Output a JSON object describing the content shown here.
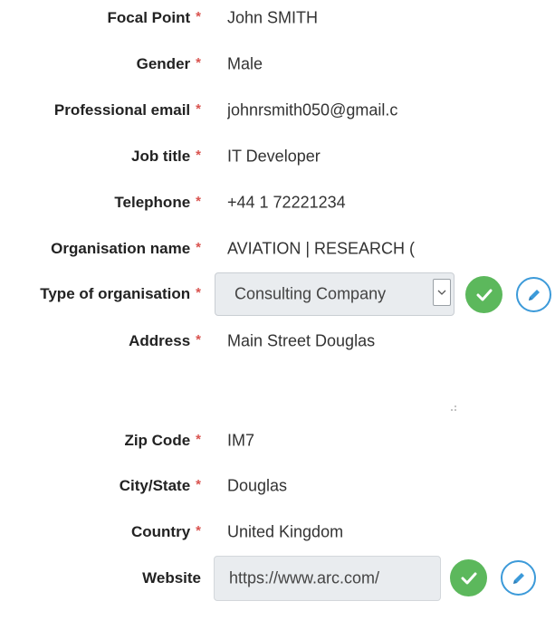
{
  "required_marker": "*",
  "fields": {
    "focal_point": {
      "label": "Focal Point",
      "value": "John SMITH"
    },
    "gender": {
      "label": "Gender",
      "value": "Male"
    },
    "professional_email": {
      "label": "Professional email",
      "value": "johnrsmith050@gmail.c"
    },
    "job_title": {
      "label": "Job title",
      "value": "IT Developer"
    },
    "telephone": {
      "label": "Telephone",
      "value": "+44 1 72221234"
    },
    "organisation_name": {
      "label": "Organisation name",
      "value": "AVIATION | RESEARCH ("
    },
    "type_of_organisation": {
      "label": "Type of organisation",
      "selected": "Consulting Company"
    },
    "address": {
      "label": "Address",
      "value": "Main Street Douglas"
    },
    "zip_code": {
      "label": "Zip Code",
      "value": "IM7"
    },
    "city_state": {
      "label": "City/State",
      "value": "Douglas"
    },
    "country": {
      "label": "Country",
      "value": "United Kingdom"
    },
    "website": {
      "label": "Website",
      "value": "https://www.arc.com/"
    }
  },
  "icons": {
    "confirm": "check-icon",
    "edit": "pencil-icon",
    "dropdown": "chevron-down-icon",
    "resize": "resize-grip-icon"
  },
  "colors": {
    "required": "#d9534f",
    "confirm_button": "#5cb85c",
    "edit_button": "#3c9ad9",
    "disabled_input_bg": "#e9ecef"
  }
}
